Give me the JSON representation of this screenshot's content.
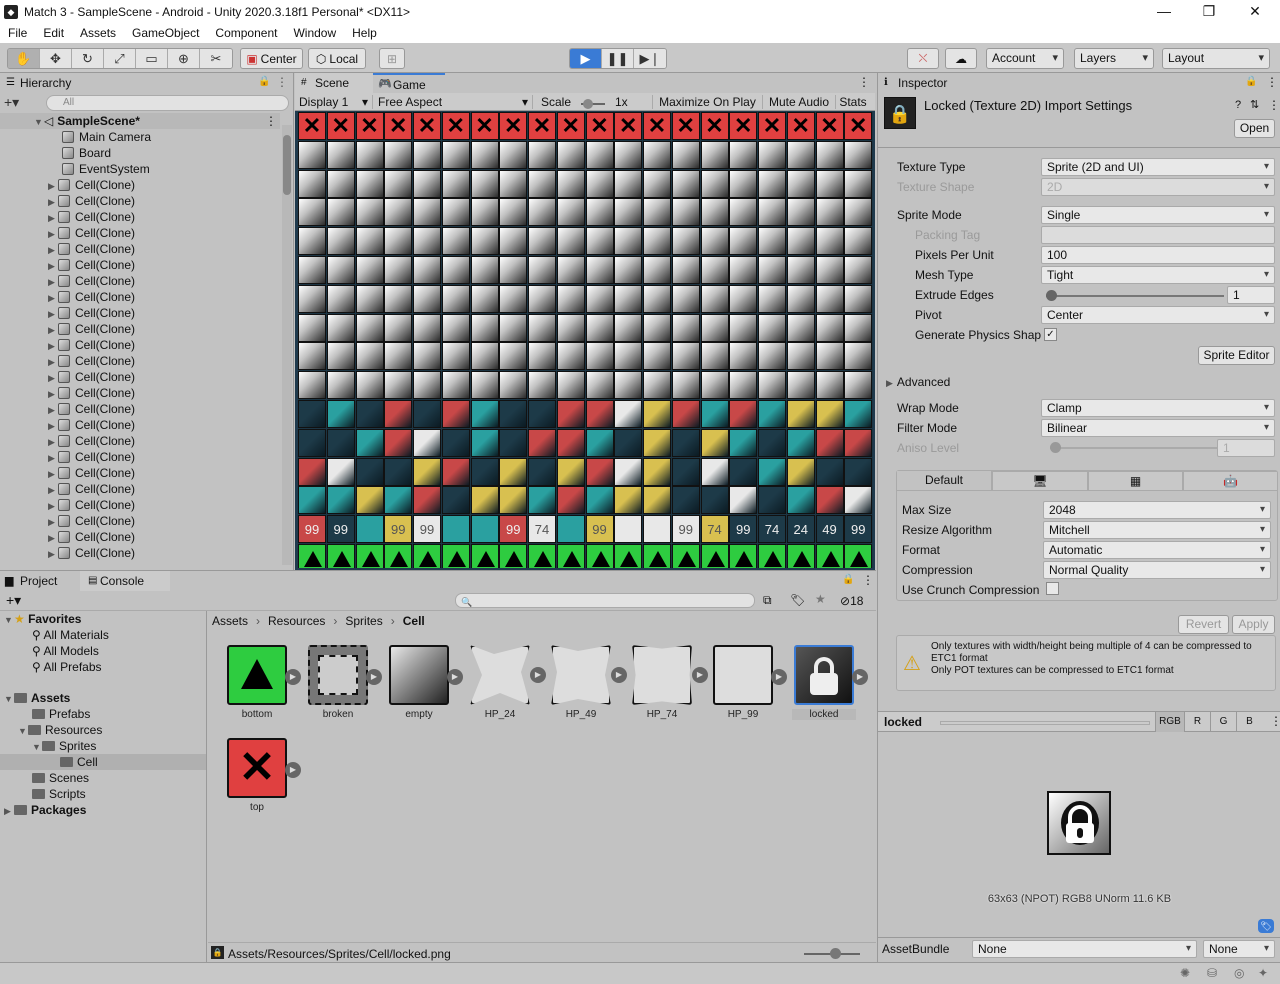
{
  "window": {
    "title": "Match 3 - SampleScene - Android - Unity 2020.3.18f1 Personal* <DX11>"
  },
  "menu": [
    "File",
    "Edit",
    "Assets",
    "GameObject",
    "Component",
    "Window",
    "Help"
  ],
  "toolbar": {
    "pivot": "Center",
    "space": "Local",
    "account": "Account",
    "layers": "Layers",
    "layout": "Layout"
  },
  "hierarchy": {
    "tab": "Hierarchy",
    "search_placeholder": "All",
    "scene": "SampleScene*",
    "items": [
      "Main Camera",
      "Board",
      "EventSystem"
    ],
    "clone_label": "Cell(Clone)"
  },
  "scene_tabs": {
    "scene": "Scene",
    "game": "Game"
  },
  "game_bar": {
    "display": "Display 1",
    "aspect": "Free Aspect",
    "scale_label": "Scale",
    "scale_value": "1x",
    "maximize": "Maximize On Play",
    "mute": "Mute Audio",
    "stats": "Stats"
  },
  "game_view": {
    "colors": {
      "top": "#e04040",
      "bottom": "#2ecc40",
      "red": "#c84848",
      "teal": "#2aa0a0",
      "yellow": "#d8c050",
      "dark": "#1d3a48",
      "white": "#e8e8e8"
    },
    "hp_row": [
      "99",
      "99",
      "",
      "99",
      "99",
      "",
      "",
      "99",
      "74",
      "",
      "99",
      "",
      "",
      "99",
      "74",
      "99",
      "74",
      "24",
      "49",
      "99"
    ]
  },
  "project": {
    "tab": "Project",
    "console_tab": "Console",
    "count": "18",
    "favorites": {
      "label": "Favorites",
      "items": [
        "All Materials",
        "All Models",
        "All Prefabs"
      ]
    },
    "assets_tree": {
      "root": "Assets",
      "prefabs": "Prefabs",
      "resources": "Resources",
      "sprites": "Sprites",
      "cell": "Cell",
      "scenes": "Scenes",
      "scripts": "Scripts",
      "packages": "Packages"
    },
    "breadcrumb": [
      "Assets",
      "Resources",
      "Sprites",
      "Cell"
    ],
    "assets": [
      "bottom",
      "broken",
      "empty",
      "HP_24",
      "HP_49",
      "HP_74",
      "HP_99",
      "locked",
      "top"
    ],
    "status_path": "Assets/Resources/Sprites/Cell/locked.png"
  },
  "inspector": {
    "tab": "Inspector",
    "title": "Locked (Texture 2D) Import Settings",
    "open": "Open",
    "props": {
      "texture_type": {
        "label": "Texture Type",
        "value": "Sprite (2D and UI)"
      },
      "texture_shape": {
        "label": "Texture Shape",
        "value": "2D"
      },
      "sprite_mode": {
        "label": "Sprite Mode",
        "value": "Single"
      },
      "packing_tag": {
        "label": "Packing Tag",
        "value": ""
      },
      "ppu": {
        "label": "Pixels Per Unit",
        "value": "100"
      },
      "mesh_type": {
        "label": "Mesh Type",
        "value": "Tight"
      },
      "extrude": {
        "label": "Extrude Edges",
        "value": "1"
      },
      "pivot": {
        "label": "Pivot",
        "value": "Center"
      },
      "physics": {
        "label": "Generate Physics Shap",
        "value": "✓"
      },
      "sprite_editor": "Sprite Editor",
      "advanced": "Advanced",
      "wrap": {
        "label": "Wrap Mode",
        "value": "Clamp"
      },
      "filter": {
        "label": "Filter Mode",
        "value": "Bilinear"
      },
      "aniso": {
        "label": "Aniso Level",
        "value": "1"
      }
    },
    "platform_tabs": [
      "Default"
    ],
    "platform": {
      "max_size": {
        "label": "Max Size",
        "value": "2048"
      },
      "resize": {
        "label": "Resize Algorithm",
        "value": "Mitchell"
      },
      "format": {
        "label": "Format",
        "value": "Automatic"
      },
      "compression": {
        "label": "Compression",
        "value": "Normal Quality"
      },
      "crunch": {
        "label": "Use Crunch Compression"
      }
    },
    "revert": "Revert",
    "apply": "Apply",
    "warning1": "Only textures with width/height being multiple of 4 can be compressed to ETC1 format",
    "warning2": "Only POT textures can be compressed to ETC1 format",
    "preview": {
      "name": "locked",
      "channels": [
        "RGB",
        "R",
        "G",
        "B"
      ],
      "info": "63x63 (NPOT)  RGB8 UNorm  11.6 KB"
    },
    "assetbundle": {
      "label": "AssetBundle",
      "value": "None",
      "variant": "None"
    }
  }
}
